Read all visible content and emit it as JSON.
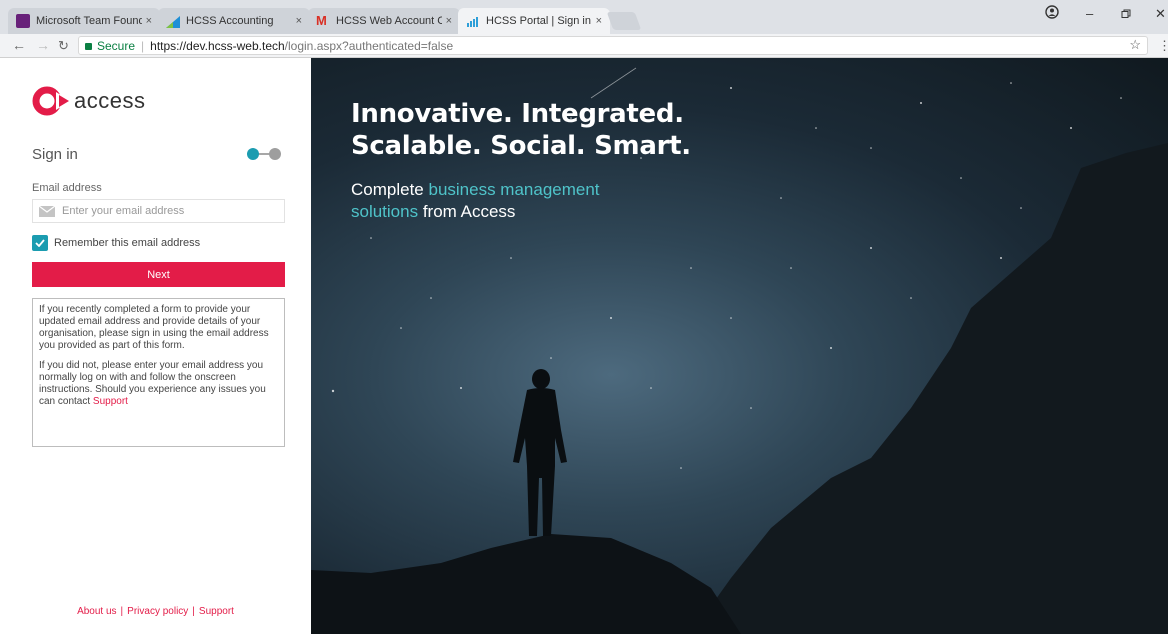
{
  "browser": {
    "tabs": [
      {
        "title": "Microsoft Team Foundati",
        "icon": "vs-icon",
        "active": false
      },
      {
        "title": "HCSS Accounting",
        "icon": "chart-icon",
        "active": false
      },
      {
        "title": "HCSS Web Account Crea",
        "icon": "gmail-icon",
        "active": false
      },
      {
        "title": "HCSS Portal | Sign in",
        "icon": "bars-icon",
        "active": true
      }
    ],
    "tab_close": "×",
    "secure_label": "Secure",
    "url_main": "https://dev.hcss-web.tech",
    "url_path": "/login.aspx?authenticated=false"
  },
  "login": {
    "logo_text": "access",
    "signin_title": "Sign in",
    "email_label": "Email address",
    "email_placeholder": "Enter your email address",
    "email_value": "",
    "remember_label": "Remember this email address",
    "remember_checked": true,
    "next_label": "Next",
    "info_p1": "If you recently completed a form to provide your updated email address and provide details of your organisation, please sign in using the email address you provided as part of this form.",
    "info_p2_text": "If you did not, please enter your email address you normally log on with and follow the onscreen instructions. Should you experience any issues you can contact ",
    "info_p2_link": "Support",
    "footer": {
      "about": "About us",
      "privacy": "Privacy policy",
      "support": "Support",
      "separator": "|"
    }
  },
  "hero": {
    "headline_line1": "Innovative. Integrated.",
    "headline_line2": "Scalable. Social. Smart.",
    "sub_prefix": "Complete ",
    "sub_highlight1": "business management",
    "sub_highlight2": "solutions",
    "sub_suffix": " from Access"
  },
  "colors": {
    "brand_red": "#e31c48",
    "teal": "#4fc3c9",
    "check_teal": "#1b9cb0"
  }
}
